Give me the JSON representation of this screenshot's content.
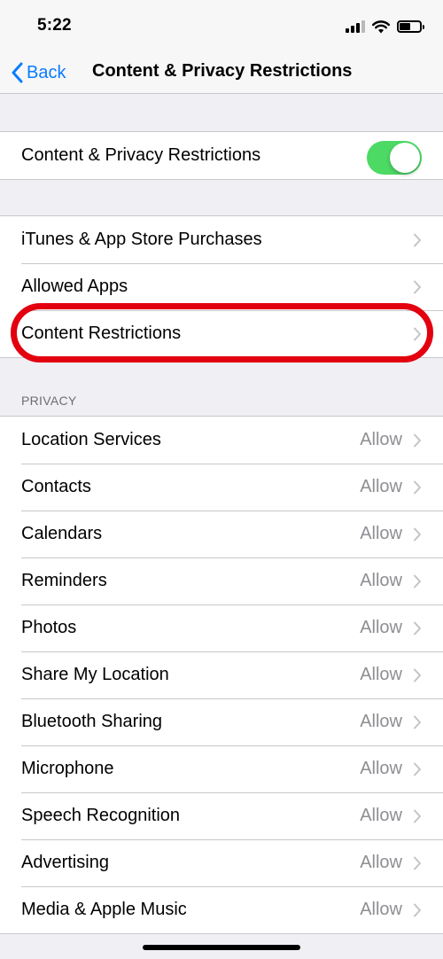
{
  "status_bar": {
    "time": "5:22"
  },
  "nav": {
    "back_label": "Back",
    "title": "Content & Privacy Restrictions"
  },
  "master_toggle": {
    "label": "Content & Privacy Restrictions",
    "on": true
  },
  "store_group": [
    {
      "label": "iTunes & App Store Purchases"
    },
    {
      "label": "Allowed Apps"
    },
    {
      "label": "Content Restrictions"
    }
  ],
  "privacy": {
    "header": "PRIVACY",
    "items": [
      {
        "label": "Location Services",
        "value": "Allow"
      },
      {
        "label": "Contacts",
        "value": "Allow"
      },
      {
        "label": "Calendars",
        "value": "Allow"
      },
      {
        "label": "Reminders",
        "value": "Allow"
      },
      {
        "label": "Photos",
        "value": "Allow"
      },
      {
        "label": "Share My Location",
        "value": "Allow"
      },
      {
        "label": "Bluetooth Sharing",
        "value": "Allow"
      },
      {
        "label": "Microphone",
        "value": "Allow"
      },
      {
        "label": "Speech Recognition",
        "value": "Allow"
      },
      {
        "label": "Advertising",
        "value": "Allow"
      },
      {
        "label": "Media & Apple Music",
        "value": "Allow"
      }
    ]
  },
  "colors": {
    "accent": "#0a7cff",
    "toggle_on": "#4cd964",
    "highlight": "#e3000f",
    "background": "#efeff4"
  }
}
